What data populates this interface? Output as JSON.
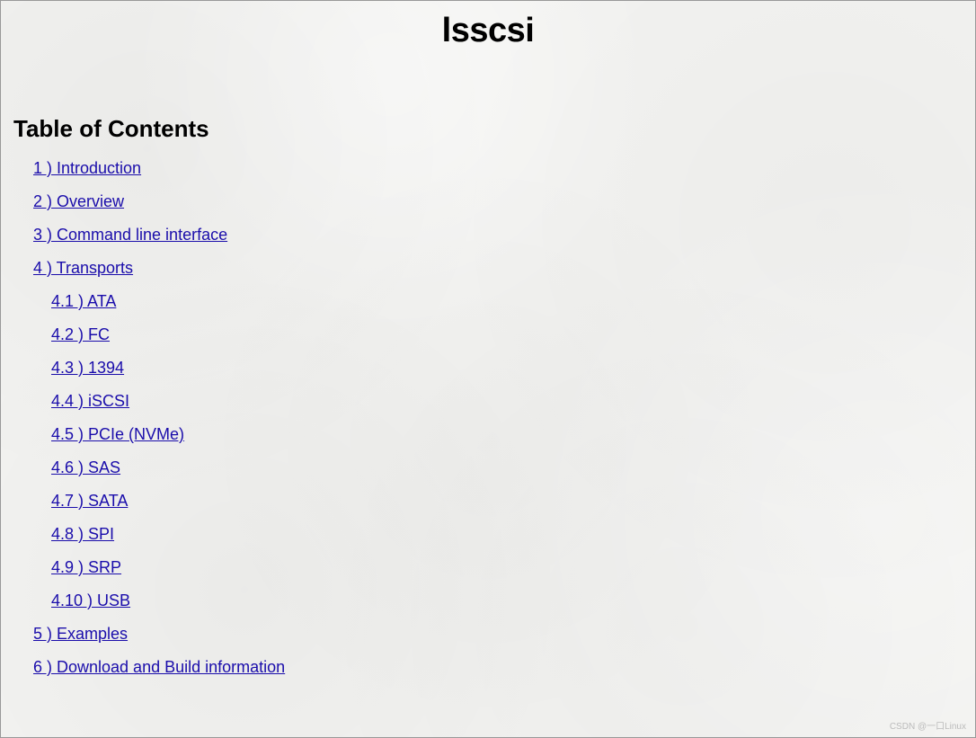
{
  "title": "lsscsi",
  "toc_heading": "Table of Contents",
  "toc": [
    {
      "label": "1 ) Introduction"
    },
    {
      "label": "2 ) Overview"
    },
    {
      "label": "3 ) Command line interface"
    },
    {
      "label": "4 ) Transports",
      "children": [
        {
          "label": "4.1 ) ATA"
        },
        {
          "label": "4.2 ) FC"
        },
        {
          "label": "4.3 ) 1394"
        },
        {
          "label": "4.4 ) iSCSI"
        },
        {
          "label": "4.5 ) PCIe (NVMe)"
        },
        {
          "label": "4.6 ) SAS"
        },
        {
          "label": "4.7 ) SATA"
        },
        {
          "label": "4.8 ) SPI"
        },
        {
          "label": "4.9 ) SRP"
        },
        {
          "label": "4.10 ) USB"
        }
      ]
    },
    {
      "label": "5 ) Examples"
    },
    {
      "label": "6 ) Download and Build information"
    }
  ],
  "watermark": "CSDN @一口Linux"
}
